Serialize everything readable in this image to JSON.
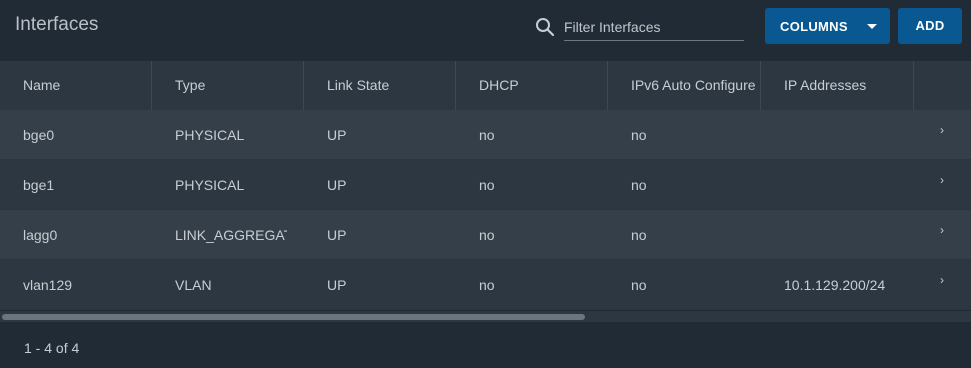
{
  "header": {
    "title": "Interfaces",
    "search_placeholder": "Filter Interfaces",
    "columns_button": "COLUMNS",
    "add_button": "ADD"
  },
  "table": {
    "columns": [
      "Name",
      "Type",
      "Link State",
      "DHCP",
      "IPv6 Auto Configure",
      "IP Addresses"
    ],
    "rows": [
      {
        "name": "bge0",
        "type": "PHYSICAL",
        "link_state": "UP",
        "dhcp": "no",
        "ipv6": "no",
        "ip": ""
      },
      {
        "name": "bge1",
        "type": "PHYSICAL",
        "link_state": "UP",
        "dhcp": "no",
        "ipv6": "no",
        "ip": ""
      },
      {
        "name": "lagg0",
        "type": "LINK_AGGREGATION",
        "link_state": "UP",
        "dhcp": "no",
        "ipv6": "no",
        "ip": ""
      },
      {
        "name": "vlan129",
        "type": "VLAN",
        "link_state": "UP",
        "dhcp": "no",
        "ipv6": "no",
        "ip": "10.1.129.200/24"
      }
    ]
  },
  "footer": {
    "pagination": "1 - 4 of 4"
  },
  "icons": {
    "search": "search-icon",
    "caret": "caret-down-icon",
    "row_expand": "chevron-right-icon"
  },
  "colors": {
    "background": "#212b36",
    "header_row": "#2d3741",
    "row_alt": "#353f49",
    "primary_button": "#0a5891"
  }
}
